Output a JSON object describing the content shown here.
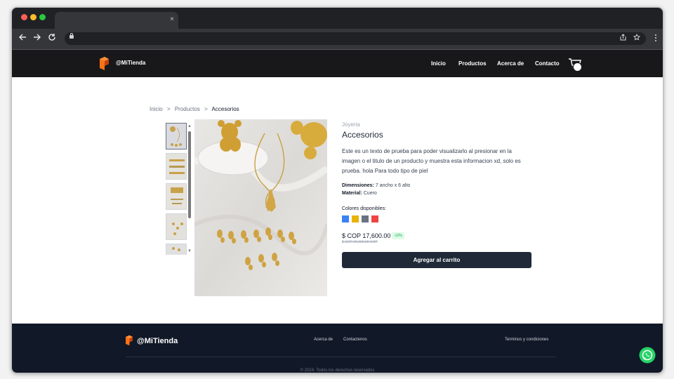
{
  "browser": {
    "tab_close": "×",
    "back_icon": "arrow-left-icon",
    "forward_icon": "arrow-right-icon",
    "reload_icon": "reload-icon",
    "share_icon": "share-icon",
    "bookmark_icon": "star-icon",
    "menu_icon": "more-vert-icon"
  },
  "header": {
    "brand": "@MiTienda",
    "nav": [
      "Inicio",
      "Productos",
      "Acerca de",
      "Contacto"
    ],
    "cart_icon": "shopping-cart-icon"
  },
  "breadcrumb": {
    "items": [
      "Inicio",
      "Productos"
    ],
    "separator": ">",
    "current": "Accesorios"
  },
  "product": {
    "category": "Joyeria",
    "title": "Accesorios",
    "description": "Este es un texto de prueba para poder visualizarlo al presionar en la imagen o el titulo de un producto y muestra esta informacion xd, solo es prueba. hola Para todo tipo de piel",
    "dimensions_label": "Dimensiones:",
    "dimensions_value": "7 ancho x 6 alto",
    "material_label": "Material:",
    "material_value": "Cuero",
    "colors_label": "Colores disponibles:",
    "colors": [
      "#3b82f6",
      "#eab308",
      "#6b7280",
      "#ef4444"
    ],
    "price": "$ COP 17,600.00",
    "discount": "-12%",
    "old_price": "$ COP 20,000.00 COP",
    "add_to_cart": "Agregar al carrito"
  },
  "footer": {
    "brand": "@MiTienda",
    "links": [
      "Acerca de",
      "Contactenos"
    ],
    "terms": "Terminos y condiciones",
    "copyright": "© 2024. Todos los derechos reservados"
  },
  "theme": {
    "header_bg": "#18181b",
    "footer_bg": "#111827",
    "brand_orange": "#f97316",
    "button_bg": "#1f2937",
    "whatsapp_green": "#25d366"
  }
}
